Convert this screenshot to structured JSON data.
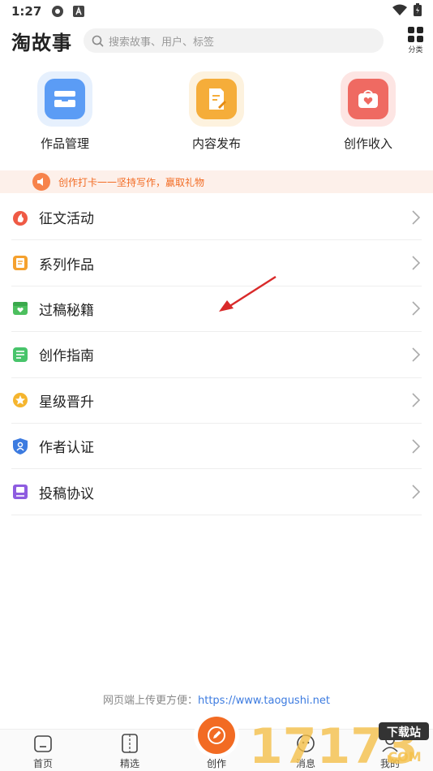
{
  "status": {
    "time": "1:27"
  },
  "header": {
    "logo": "淘故事",
    "search_placeholder": "搜索故事、用户、标签",
    "category_label": "分类"
  },
  "shortcuts": [
    {
      "label": "作品管理",
      "color": "#5b9cf5",
      "bg": "#e6f0fd"
    },
    {
      "label": "内容发布",
      "color": "#f5ad3a",
      "bg": "#fdf2de"
    },
    {
      "label": "创作收入",
      "color": "#ef6a62",
      "bg": "#fde5e3"
    }
  ],
  "notice": {
    "text": "创作打卡一一坚持写作，赢取礼物"
  },
  "menu": [
    {
      "label": "征文活动",
      "icon": "flame-icon",
      "color": "#ef5a45"
    },
    {
      "label": "系列作品",
      "icon": "book-icon",
      "color": "#f5a12e"
    },
    {
      "label": "过稿秘籍",
      "icon": "box-icon",
      "color": "#4cbf5e"
    },
    {
      "label": "创作指南",
      "icon": "document-icon",
      "color": "#48c46b"
    },
    {
      "label": "星级晋升",
      "icon": "star-icon",
      "color": "#f5b52e"
    },
    {
      "label": "作者认证",
      "icon": "shield-icon",
      "color": "#3c7be0"
    },
    {
      "label": "投稿协议",
      "icon": "agreement-icon",
      "color": "#8e5ce0"
    }
  ],
  "footer": {
    "prefix": "网页端上传更方便：",
    "url": "https://www.taogushi.net"
  },
  "tabs": [
    {
      "label": "首页"
    },
    {
      "label": "精选"
    },
    {
      "label": "创作"
    },
    {
      "label": "消息"
    },
    {
      "label": "我的"
    }
  ],
  "watermark": {
    "text": "17173",
    "badge": "下载站",
    "suffix": "COM"
  }
}
